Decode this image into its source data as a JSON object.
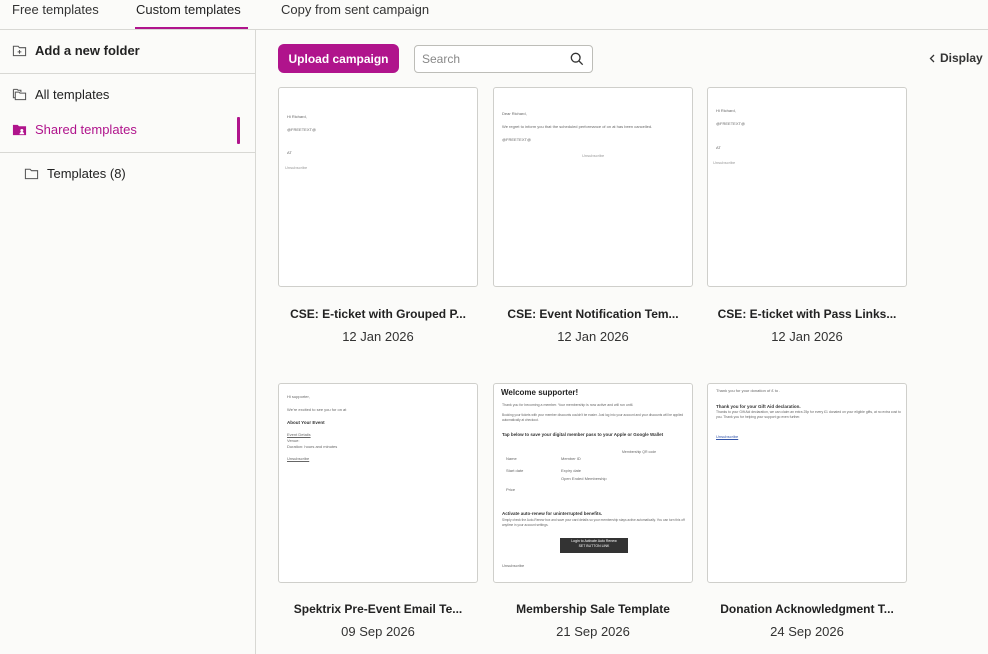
{
  "tabs": [
    {
      "label": "Free templates"
    },
    {
      "label": "Custom templates"
    },
    {
      "label": "Copy from sent campaign"
    }
  ],
  "sidebar": {
    "add_folder": "Add a new folder",
    "all_templates": "All templates",
    "shared_templates": "Shared templates",
    "folder": "Templates (8)"
  },
  "toolbar": {
    "upload": "Upload campaign",
    "search_placeholder": "Search",
    "display": "Display"
  },
  "colors": {
    "accent": "#b0148c"
  },
  "cards": [
    {
      "title": "CSE: E-ticket with Grouped P...",
      "date": "12 Jan 2026",
      "preview": [
        "Hi Richard,",
        "@FREETEXT@",
        "AT",
        "Unsubscribe"
      ]
    },
    {
      "title": "CSE: Event Notification Tem...",
      "date": "12 Jan 2026",
      "preview": [
        "Dear Richard,",
        "We regret to inform you that the scheduled performance of on at has been cancelled.",
        "@FREETEXT@",
        "Unsubscribe"
      ]
    },
    {
      "title": "CSE: E-ticket with Pass Links...",
      "date": "12 Jan 2026",
      "preview": [
        "Hi Richard,",
        "@FREETEXT@",
        "AT",
        "Unsubscribe"
      ]
    },
    {
      "title": "Spektrix Pre-Event Email Te...",
      "date": "09 Sep 2026",
      "preview": [
        "Hi supporter,",
        "We're excited to see you for on at",
        "About Your Event",
        "Event Details",
        "Venue:",
        "Duration: hours and minutes",
        "Unsubscribe"
      ]
    },
    {
      "title": "Membership Sale Template",
      "date": "21 Sep 2026",
      "preview": [
        "Welcome supporter!",
        "Thank you for becoming a member. Your membership is now active and will run until.",
        "Booking your tickets with your member discounts couldn't be easier. Just log into your account and your discounts will be applied automatically at checkout.",
        "Tap below to save your digital member pass to your Apple or Google Wallet",
        "Membership QR code",
        "Name",
        "Member ID",
        "Start date",
        "Expiry date",
        "Open Ended Membership",
        "Price",
        "Activate auto-renew for uninterrupted benefits.",
        "Simply check the Auto-Renew box and save your card details so your membership stays active automatically. You can turn this off anytime in your account settings.",
        "Login to Activate Auto Renew",
        "SET BUTTON LINK",
        "Unsubscribe"
      ]
    },
    {
      "title": "Donation Acknowledgment T...",
      "date": "24 Sep 2026",
      "preview": [
        "Thank you for your donation of £ to .",
        "Thank you for your Gift Aid declaration.",
        "Thanks to your Gift Aid declaration, we can claim an extra 25p for every £1 donated on your eligible gifts, at no extra cost to you. Thank you for helping your support go even further.",
        "Unsubscribe"
      ]
    }
  ]
}
